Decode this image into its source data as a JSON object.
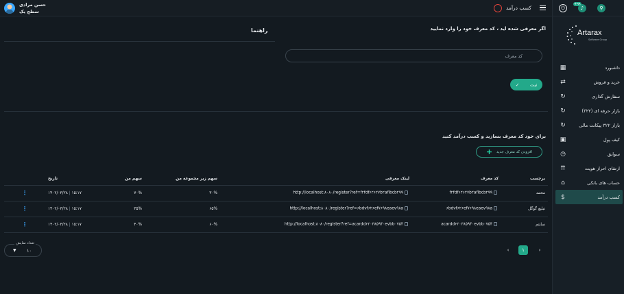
{
  "header": {
    "page_title": "کسب درآمد",
    "user_name": "حسن مرادی",
    "user_level": "سطح یک",
    "notif_count": "+۹۹"
  },
  "brand": {
    "logo_text": "Artarax",
    "logo_sub": "Software Group"
  },
  "sidebar": {
    "items": [
      {
        "label": "داشبورد"
      },
      {
        "label": "خرید و فروش"
      },
      {
        "label": "سفارش گذاری"
      },
      {
        "label": "بازار حرفه ای (۳۲۲)"
      },
      {
        "label": "بازار ۳۲۲ پیکانت مالی"
      },
      {
        "label": "کیف پول"
      },
      {
        "label": "سوابق"
      },
      {
        "label": "ارتقای احراز هویت"
      },
      {
        "label": "حساب های بانکی"
      },
      {
        "label": "کسب درآمد"
      }
    ]
  },
  "referral": {
    "title": "اگر معرفی شده اید ، کد معرف خود را وارد نمایید",
    "placeholder": "کد معرف",
    "submit_label": "ثبت"
  },
  "guide": {
    "title": "راهنما"
  },
  "create": {
    "title": "برای خود کد معرف بسازید و کسب درآمد کنید",
    "add_label": "افزودن کد معرف جدید"
  },
  "table": {
    "headers": {
      "label": "برچسب",
      "code": "کد معرف",
      "link": "لینک معرفی",
      "sub_share": "سهم زیر مجموعه من",
      "my_share": "سهم من",
      "date": "تاریخ"
    },
    "rows": [
      {
        "label": "محمد",
        "code": "f۲fdf۶۲۶۲۷b۲aflbcb۲۹۹",
        "link": "http://localhost:۸۰۸۰/register?ref=f۲fdf۶۲۶۲۷b۲aflbcb۲۹۹",
        "sub_share": "۳۰%",
        "my_share": "۷۰%",
        "time": "۱۵:۱۷",
        "date": "۱۴۰۲/۰۳/۲۸"
      },
      {
        "label": "تبلیغ گوگل",
        "code": "۶bdvf۶۲۶ef۷۶۹۸eaev۹۸a",
        "link": "http://localhost:۸۰۸۰/register?ref=۶bdvf۶۲۶ef۷۶۹۸eaev۹۸a",
        "sub_share": "۶۵%",
        "my_share": "۳۵%",
        "time": "۱۵:۱۷",
        "date": "۱۴۰۲/۰۳/۲۸"
      },
      {
        "label": "سایتم",
        "code": "acardd۶۲۰۳۸۵۹۴۰evbb۰۷۵۴",
        "link": "http://localhost:۸۰۸۰/register?ref=acardd۶۲۰۳۸۵۹۴۰evbb۰۷۵۴",
        "sub_share": "۶۰%",
        "my_share": "۴۰%",
        "time": "۱۵:۱۷",
        "date": "۱۴۰۲/۰۳/۲۸"
      }
    ]
  },
  "pagination": {
    "current": "۱",
    "per_page_label": "تعداد نمایش",
    "per_page": "۱۰"
  },
  "colors": {
    "accent": "#23a98a",
    "link": "#3aa7ff",
    "danger": "#e0433a"
  }
}
